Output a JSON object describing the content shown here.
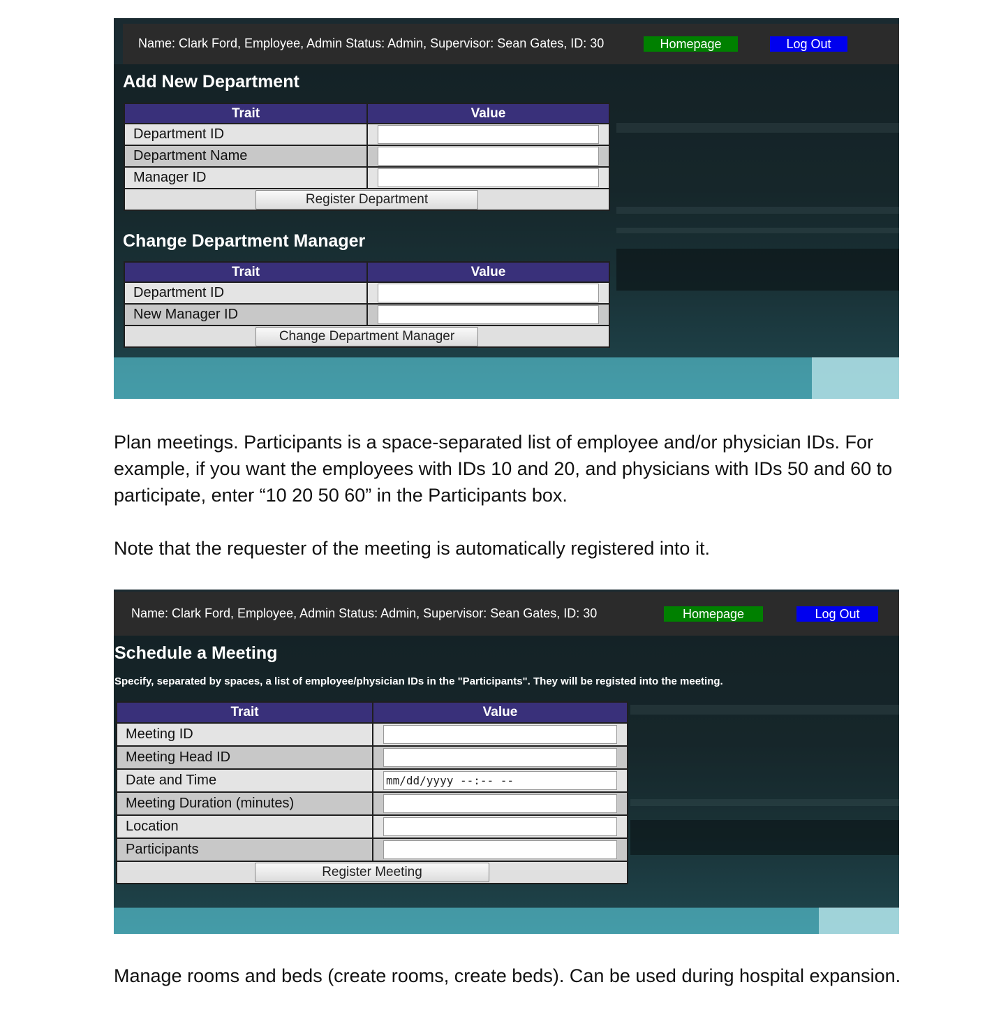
{
  "header": {
    "user_info": "Name: Clark Ford, Employee, Admin Status: Admin, Supervisor: Sean Gates, ID: 30",
    "homepage_label": "Homepage",
    "logout_label": "Log Out"
  },
  "add_department": {
    "title": "Add New Department",
    "col_trait": "Trait",
    "col_value": "Value",
    "rows": [
      "Department ID",
      "Department Name",
      "Manager ID"
    ],
    "submit_label": "Register Department"
  },
  "change_manager": {
    "title": "Change Department Manager",
    "col_trait": "Trait",
    "col_value": "Value",
    "rows": [
      "Department ID",
      "New Manager ID"
    ],
    "submit_label": "Change Department Manager"
  },
  "paragraph_meetings": "Plan meetings. Participants is a space-separated list of employee and/or physician IDs. For example, if you want the employees with IDs 10 and 20, and physicians with IDs 50 and 60 to participate, enter “10 20 50 60” in the Participants box.",
  "paragraph_note": "Note that the requester of the meeting is automatically registered into it.",
  "schedule_meeting": {
    "title": "Schedule a Meeting",
    "instructions": "Specify, separated by spaces, a list of employee/physician IDs in the \"Participants\". They will be registed into the meeting.",
    "col_trait": "Trait",
    "col_value": "Value",
    "rows": [
      "Meeting ID",
      "Meeting Head ID",
      "Date and Time",
      "Meeting Duration (minutes)",
      "Location",
      "Participants"
    ],
    "datetime_placeholder": "mm/dd/yyyy --:-- --",
    "submit_label": "Register Meeting"
  },
  "paragraph_rooms": "Manage rooms and beds (create rooms, create beds). Can be used during hospital expansion."
}
